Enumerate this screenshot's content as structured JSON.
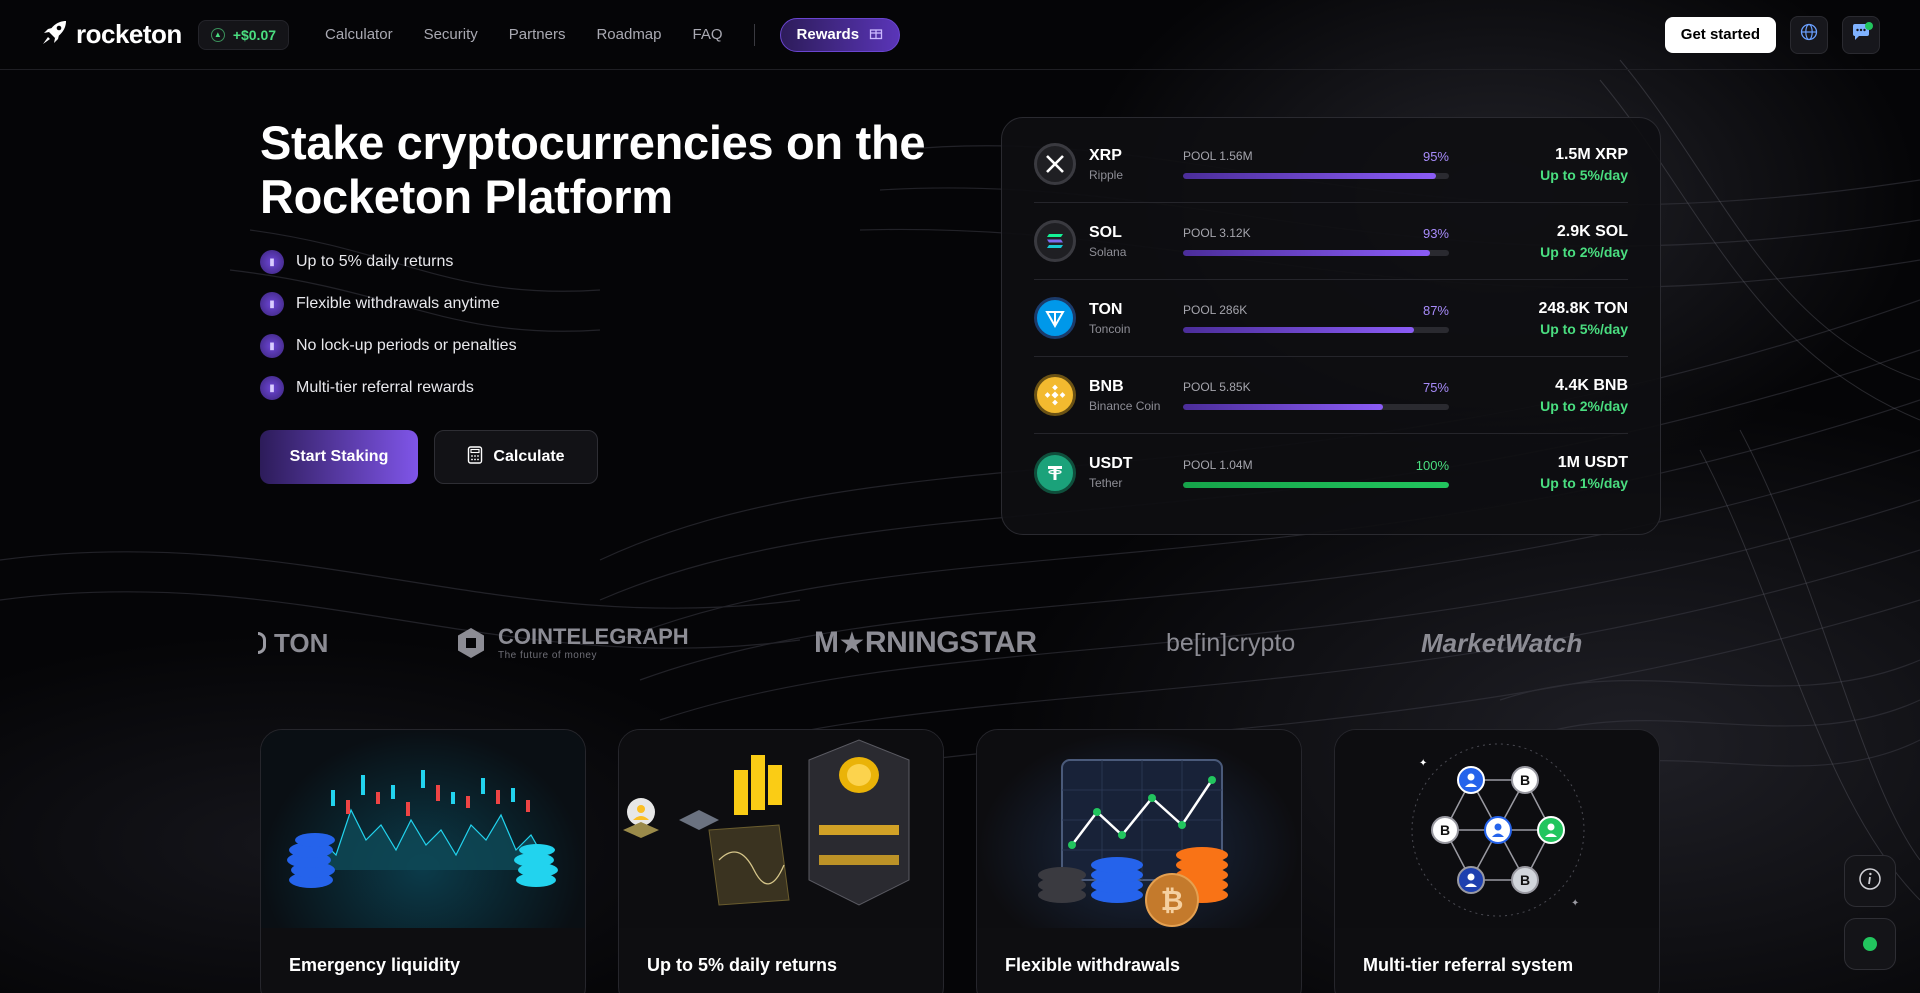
{
  "header": {
    "logo_text": "rocketon",
    "price_change": "+$0.07",
    "nav": [
      "Calculator",
      "Security",
      "Partners",
      "Roadmap",
      "FAQ"
    ],
    "rewards_label": "Rewards",
    "get_started_label": "Get started",
    "icons": [
      "rocket-icon",
      "globe-icon",
      "chat-icon",
      "gift-icon"
    ]
  },
  "hero": {
    "title_line1": "Stake cryptocurrencies on the",
    "title_line2": "Rocketon Platform",
    "features": [
      "Up to 5% daily returns",
      "Flexible withdrawals anytime",
      "No lock-up periods or penalties",
      "Multi-tier referral rewards"
    ],
    "start_label": "Start Staking",
    "calculate_label": "Calculate"
  },
  "pools": [
    {
      "symbol": "XRP",
      "name": "Ripple",
      "pool": "POOL 1.56M",
      "pct": "95%",
      "fill": 95,
      "amount": "1.5M XRP",
      "rate": "Up to 5%/day",
      "color": "#8b5cf6"
    },
    {
      "symbol": "SOL",
      "name": "Solana",
      "pool": "POOL 3.12K",
      "pct": "93%",
      "fill": 93,
      "amount": "2.9K SOL",
      "rate": "Up to 2%/day",
      "color": "#8b5cf6"
    },
    {
      "symbol": "TON",
      "name": "Toncoin",
      "pool": "POOL 286K",
      "pct": "87%",
      "fill": 87,
      "amount": "248.8K TON",
      "rate": "Up to 5%/day",
      "color": "#8b5cf6"
    },
    {
      "symbol": "BNB",
      "name": "Binance Coin",
      "pool": "POOL 5.85K",
      "pct": "75%",
      "fill": 75,
      "amount": "4.4K BNB",
      "rate": "Up to 2%/day",
      "color": "#8b5cf6"
    },
    {
      "symbol": "USDT",
      "name": "Tether",
      "pool": "POOL 1.04M",
      "pct": "100%",
      "fill": 100,
      "amount": "1M USDT",
      "rate": "Up to 1%/day",
      "color": "#22c55e"
    }
  ],
  "partners": {
    "ton": "TON",
    "cointelegraph": "COINTELEGRAPH",
    "cointelegraph_sub": "The future of money",
    "morningstar_m": "M",
    "morningstar_rest": "RNINGSTAR",
    "beincrypto_be": "be",
    "beincrypto_in": "[in]",
    "beincrypto_crypto": "crypto",
    "marketwatch": "MarketWatch"
  },
  "cards": [
    {
      "title": "Emergency liquidity"
    },
    {
      "title": "Up to 5% daily returns"
    },
    {
      "title": "Flexible withdrawals"
    },
    {
      "title": "Multi-tier referral system"
    }
  ],
  "colors": {
    "accent": "#7f55e8",
    "positive": "#4ade80"
  }
}
